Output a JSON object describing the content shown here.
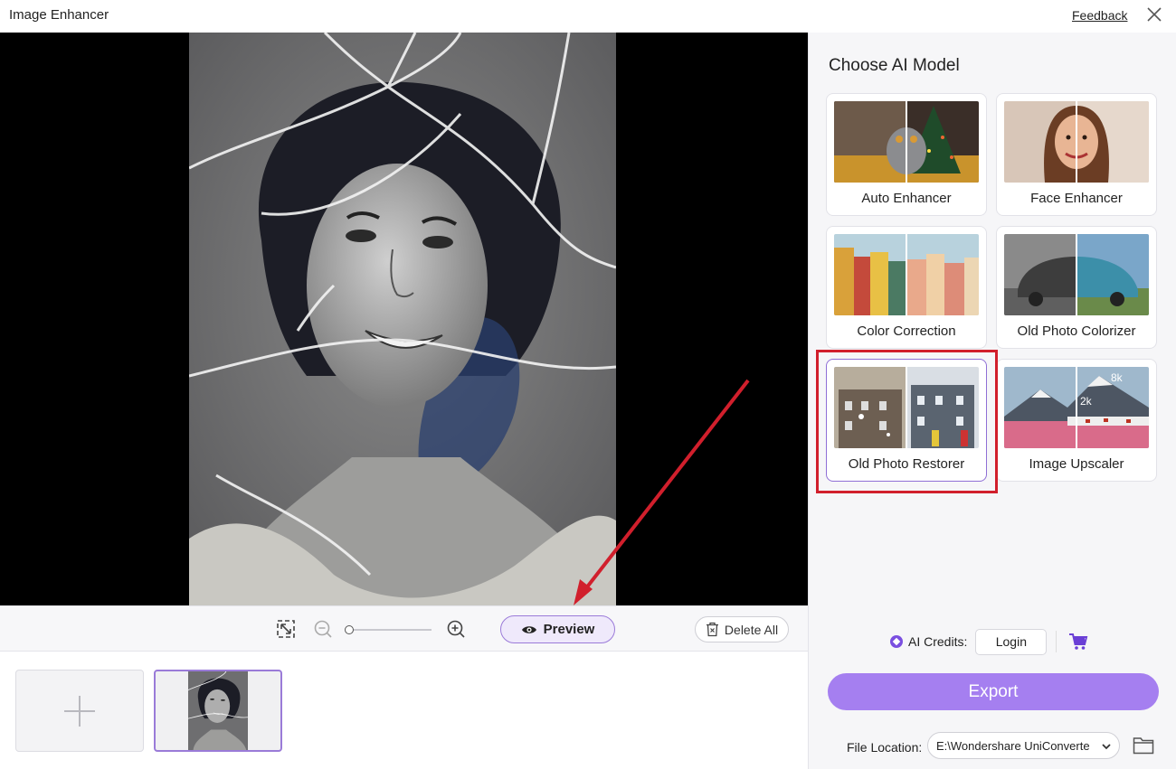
{
  "window": {
    "title": "Image Enhancer",
    "feedback_label": "Feedback",
    "close_icon": "close-icon"
  },
  "canvas": {
    "image_description_icon": "portrait-photo"
  },
  "toolbar": {
    "fit_icon": "fit-screen-icon",
    "zoom_out_icon": "zoom-out-icon",
    "zoom_in_icon": "zoom-in-icon",
    "zoom_level": 0,
    "preview_label": "Preview",
    "delete_all_label": "Delete All"
  },
  "thumbnails": {
    "add_icon": "plus-icon"
  },
  "panel": {
    "title": "Choose AI Model",
    "models": [
      {
        "label": "Auto Enhancer",
        "selected": false
      },
      {
        "label": "Face Enhancer",
        "selected": false
      },
      {
        "label": "Color Correction",
        "selected": false
      },
      {
        "label": "Old Photo Colorizer",
        "selected": false
      },
      {
        "label": "Old Photo Restorer",
        "selected": true
      },
      {
        "label": "Image Upscaler",
        "selected": false
      }
    ],
    "upscaler_badges": [
      "8k",
      "2k"
    ]
  },
  "credits": {
    "label": "AI Credits:",
    "login_label": "Login"
  },
  "export": {
    "label": "Export"
  },
  "file_location": {
    "label": "File Location:",
    "value": "E:\\Wondershare UniConverte"
  },
  "colors": {
    "accent": "#a57ff0",
    "accent_border": "#9b7bd9",
    "highlight_red": "#d11f2c"
  }
}
